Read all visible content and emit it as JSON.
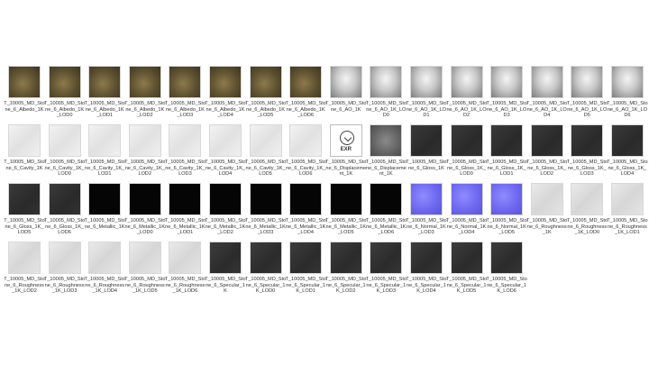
{
  "files": [
    {
      "label": "T_10005_MD_Stone_6_Albedo_1K",
      "kind": "albedo"
    },
    {
      "label": "T_10005_MD_Stone_6_Albedo_1K_LOD0",
      "kind": "albedo"
    },
    {
      "label": "T_10005_MD_Stone_6_Albedo_1K_LOD1",
      "kind": "albedo"
    },
    {
      "label": "T_10005_MD_Stone_6_Albedo_1K_LOD2",
      "kind": "albedo"
    },
    {
      "label": "T_10005_MD_Stone_6_Albedo_1K_LOD3",
      "kind": "albedo"
    },
    {
      "label": "T_10005_MD_Stone_6_Albedo_1K_LOD4",
      "kind": "albedo"
    },
    {
      "label": "T_10005_MD_Stone_6_Albedo_1K_LOD5",
      "kind": "albedo"
    },
    {
      "label": "T_10005_MD_Stone_6_Albedo_1K_LOD6",
      "kind": "albedo"
    },
    {
      "label": "T_10005_MD_Stone_6_AO_1K",
      "kind": "ao"
    },
    {
      "label": "T_10005_MD_Stone_6_AO_1K_LOD0",
      "kind": "ao"
    },
    {
      "label": "T_10005_MD_Stone_6_AO_1K_LOD1",
      "kind": "ao"
    },
    {
      "label": "T_10005_MD_Stone_6_AO_1K_LOD2",
      "kind": "ao"
    },
    {
      "label": "T_10005_MD_Stone_6_AO_1K_LOD3",
      "kind": "ao"
    },
    {
      "label": "T_10005_MD_Stone_6_AO_1K_LOD4",
      "kind": "ao"
    },
    {
      "label": "T_10005_MD_Stone_6_AO_1K_LOD5",
      "kind": "ao"
    },
    {
      "label": "T_10005_MD_Stone_6_AO_1K_LOD6",
      "kind": "ao"
    },
    {
      "label": "T_10005_MD_Stone_6_Cavity_1K",
      "kind": "cavity"
    },
    {
      "label": "T_10005_MD_Stone_6_Cavity_1K_LOD0",
      "kind": "cavity"
    },
    {
      "label": "T_10005_MD_Stone_6_Cavity_1K_LOD1",
      "kind": "cavity"
    },
    {
      "label": "T_10005_MD_Stone_6_Cavity_1K_LOD2",
      "kind": "cavity"
    },
    {
      "label": "T_10005_MD_Stone_6_Cavity_1K_LOD3",
      "kind": "cavity"
    },
    {
      "label": "T_10005_MD_Stone_6_Cavity_1K_LOD4",
      "kind": "cavity"
    },
    {
      "label": "T_10005_MD_Stone_6_Cavity_1K_LOD5",
      "kind": "cavity"
    },
    {
      "label": "T_10005_MD_Stone_6_Cavity_1K_LOD6",
      "kind": "cavity"
    },
    {
      "label": "T_10005_MD_Stone_6_Displacement_1K",
      "kind": "exr",
      "icon_text": "EXR"
    },
    {
      "label": "T_10005_MD_Stone_6_Displacement_1K",
      "kind": "displace"
    },
    {
      "label": "T_10005_MD_Stone_6_Gloss_1K",
      "kind": "gloss"
    },
    {
      "label": "T_10005_MD_Stone_6_Gloss_1K_LOD0",
      "kind": "gloss"
    },
    {
      "label": "T_10005_MD_Stone_6_Gloss_1K_LOD1",
      "kind": "gloss"
    },
    {
      "label": "T_10005_MD_Stone_6_Gloss_1K_LOD2",
      "kind": "gloss"
    },
    {
      "label": "T_10005_MD_Stone_6_Gloss_1K_LOD3",
      "kind": "gloss"
    },
    {
      "label": "T_10005_MD_Stone_6_Gloss_1K_LOD4",
      "kind": "gloss"
    },
    {
      "label": "T_10005_MD_Stone_6_Gloss_1K_LOD5",
      "kind": "gloss"
    },
    {
      "label": "T_10005_MD_Stone_6_Gloss_1K_LOD6",
      "kind": "gloss"
    },
    {
      "label": "T_10005_MD_Stone_6_Metallic_1K",
      "kind": "metallic"
    },
    {
      "label": "T_10005_MD_Stone_6_Metallic_1K_LOD0",
      "kind": "metallic"
    },
    {
      "label": "T_10005_MD_Stone_6_Metallic_1K_LOD1",
      "kind": "metallic"
    },
    {
      "label": "T_10005_MD_Stone_6_Metallic_1K_LOD2",
      "kind": "metallic"
    },
    {
      "label": "T_10005_MD_Stone_6_Metallic_1K_LOD3",
      "kind": "metallic"
    },
    {
      "label": "T_10005_MD_Stone_6_Metallic_1K_LOD4",
      "kind": "metallic"
    },
    {
      "label": "T_10005_MD_Stone_6_Metallic_1K_LOD5",
      "kind": "metallic"
    },
    {
      "label": "T_10005_MD_Stone_6_Metallic_1K_LOD6",
      "kind": "metallic"
    },
    {
      "label": "T_10005_MD_Stone_6_Normal_1K_LOD3",
      "kind": "normal"
    },
    {
      "label": "T_10005_MD_Stone_6_Normal_1K_LOD4",
      "kind": "normal"
    },
    {
      "label": "T_10005_MD_Stone_6_Normal_1K_LOD5",
      "kind": "normal"
    },
    {
      "label": "T_10005_MD_Stone_6_Roughness_1K",
      "kind": "rough"
    },
    {
      "label": "T_10005_MD_Stone_6_Roughness_1K_LOD0",
      "kind": "rough"
    },
    {
      "label": "T_10005_MD_Stone_6_Roughness_1K_LOD1",
      "kind": "rough"
    },
    {
      "label": "T_10005_MD_Stone_6_Roughness_1K_LOD2",
      "kind": "rough"
    },
    {
      "label": "T_10005_MD_Stone_6_Roughness_1K_LOD3",
      "kind": "rough"
    },
    {
      "label": "T_10005_MD_Stone_6_Roughness_1K_LOD4",
      "kind": "rough"
    },
    {
      "label": "T_10005_MD_Stone_6_Roughness_1K_LOD5",
      "kind": "rough"
    },
    {
      "label": "T_10005_MD_Stone_6_Roughness_1K_LOD6",
      "kind": "rough"
    },
    {
      "label": "T_10005_MD_Stone_6_Specular_1K",
      "kind": "spec"
    },
    {
      "label": "T_10005_MD_Stone_6_Specular_1K_LOD0",
      "kind": "spec"
    },
    {
      "label": "T_10005_MD_Stone_6_Specular_1K_LOD1",
      "kind": "spec"
    },
    {
      "label": "T_10005_MD_Stone_6_Specular_1K_LOD2",
      "kind": "spec"
    },
    {
      "label": "T_10005_MD_Stone_6_Specular_1K_LOD3",
      "kind": "spec"
    },
    {
      "label": "T_10005_MD_Stone_6_Specular_1K_LOD4",
      "kind": "spec"
    },
    {
      "label": "T_10005_MD_Stone_6_Specular_1K_LOD5",
      "kind": "spec"
    },
    {
      "label": "T_10005_MD_Stone_6_Specular_1K_LOD6",
      "kind": "spec"
    }
  ]
}
